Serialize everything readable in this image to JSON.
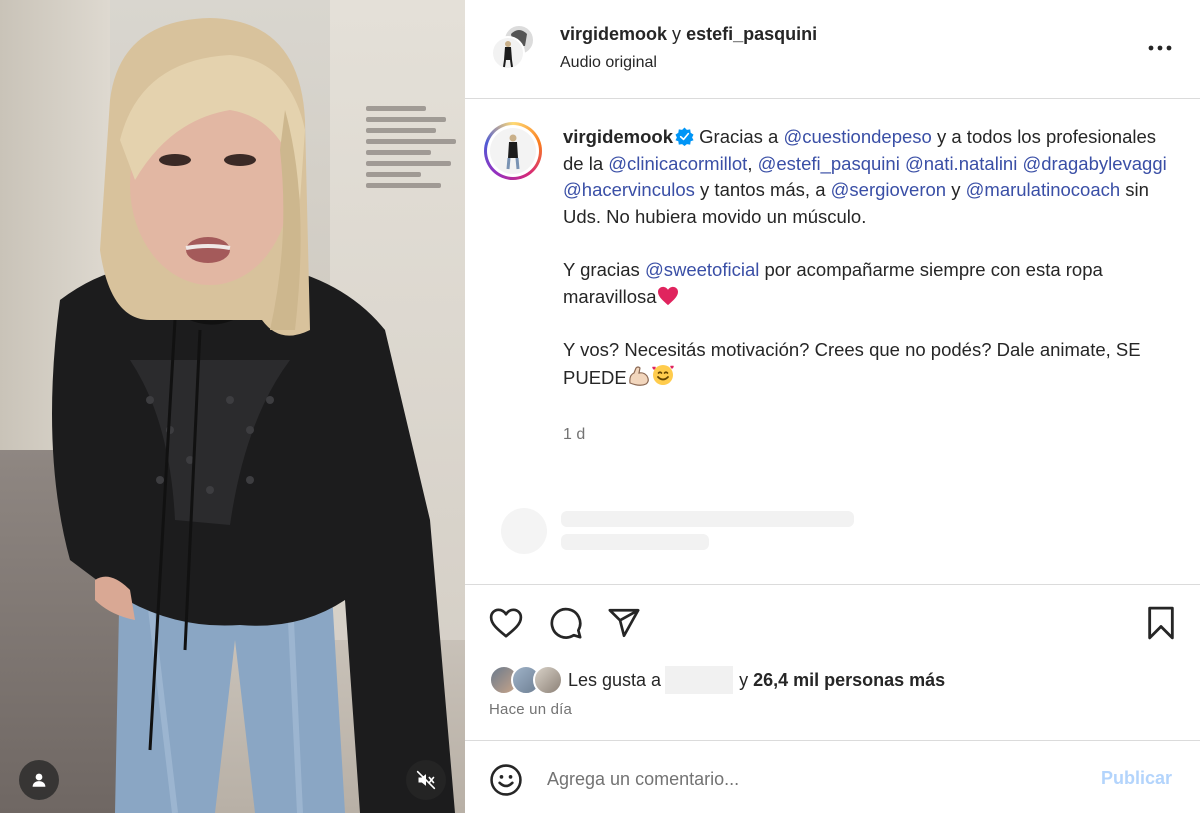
{
  "header": {
    "user1": "virgidemook",
    "conjunction": "y",
    "user2": "estefi_pasquini",
    "audio": "Audio original"
  },
  "caption": {
    "username": "virgidemook",
    "p1": [
      {
        "t": "Gracias a ",
        "m": false
      },
      {
        "t": "@cuestiondepeso",
        "m": true
      },
      {
        "t": " y a todos los profesionales de la ",
        "m": false
      },
      {
        "t": "@clinicacormillot",
        "m": true
      },
      {
        "t": ", ",
        "m": false
      },
      {
        "t": "@estefi_pasquini",
        "m": true
      },
      {
        "t": " ",
        "m": false
      },
      {
        "t": "@nati.natalini",
        "m": true
      },
      {
        "t": " ",
        "m": false
      },
      {
        "t": "@dragabylevaggi",
        "m": true
      },
      {
        "t": " ",
        "m": false
      },
      {
        "t": "@hacervinculos",
        "m": true
      },
      {
        "t": " y tantos más, a ",
        "m": false
      },
      {
        "t": "@sergioveron",
        "m": true
      },
      {
        "t": " y ",
        "m": false
      },
      {
        "t": "@marulatinocoach",
        "m": true
      },
      {
        "t": " sin Uds. No hubiera movido un músculo.",
        "m": false
      }
    ],
    "p2": [
      {
        "t": "Y gracias ",
        "m": false
      },
      {
        "t": "@sweetoficial",
        "m": true
      },
      {
        "t": " por acompañarme siempre con esta ropa maravillosa",
        "m": false
      }
    ],
    "p3": "Y vos? Necesitás motivación? Crees que no podés? Dale animate, SE PUEDE",
    "time": "1 d"
  },
  "likes": {
    "prefix": "Les gusta a",
    "suffix_y": "y",
    "count": "26,4 mil personas más",
    "posted": "Hace un día"
  },
  "comment": {
    "placeholder": "Agrega un comentario...",
    "publish": "Publicar"
  },
  "colors": {
    "mention": "#3a4fa6",
    "publish_disabled": "#b3d4fc",
    "verified": "#0095f6",
    "heart_emoji": "#e0245e"
  },
  "icons": [
    "more-options-icon",
    "verified-badge-icon",
    "heart-icon",
    "comment-icon",
    "share-icon",
    "bookmark-icon",
    "emoji-icon",
    "user-tag-icon",
    "muted-speaker-icon",
    "red-heart-emoji",
    "flexed-biceps-emoji",
    "smiling-face-with-hearts-emoji"
  ]
}
